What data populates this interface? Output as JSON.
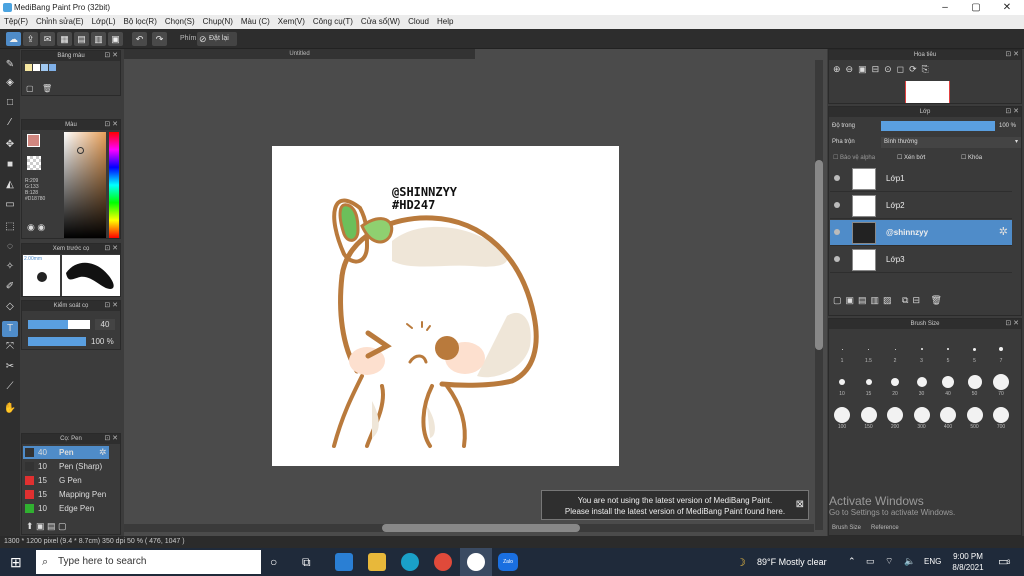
{
  "window": {
    "title": "MediBang Paint Pro (32bit)"
  },
  "menu": [
    "Tệp(F)",
    "Chỉnh sửa(E)",
    "Lớp(L)",
    "Bộ lọc(R)",
    "Chọn(S)",
    "Chụp(N)",
    "Màu (C)",
    "Xem(V)",
    "Công cụ(T)",
    "Cửa sổ(W)",
    "Cloud",
    "Help"
  ],
  "toolbar": {
    "snap_label": "Phím",
    "reset_label": "Đặt lại"
  },
  "panels": {
    "color_box": "Bảng màu",
    "color": "Màu",
    "rgb": {
      "r": "R:209",
      "g": "G:133",
      "b": "B:128",
      "hex": "#D18780"
    },
    "brush_preview": "Xem trước cọ",
    "brush_size_value": "2.00mm",
    "control": "Kiểm soát cọ",
    "control_size": "40",
    "control_opacity": "100 %",
    "brush_list_title": "Cọ: Pen",
    "brushes": [
      {
        "size": "40",
        "name": "Pen",
        "color": "#3a3a3a"
      },
      {
        "size": "10",
        "name": "Pen (Sharp)",
        "color": "#3a3a3a"
      },
      {
        "size": "15",
        "name": "G Pen",
        "color": "#e03030"
      },
      {
        "size": "15",
        "name": "Mapping Pen",
        "color": "#e03030"
      },
      {
        "size": "10",
        "name": "Edge Pen",
        "color": "#30b030"
      }
    ]
  },
  "canvas": {
    "tab_title": "Untitled",
    "text_line1": "@SHINNZYY",
    "text_line2": "#HD247"
  },
  "navigator": {
    "title": "Hoa tiêu"
  },
  "layer": {
    "title": "Lớp",
    "opacity_label": "Độ trong",
    "opacity_value": "100 %",
    "opacity_fraction": 1.0,
    "blend_label": "Pha trộn",
    "blend_value": "Bình thường",
    "protect_alpha": "Bảo vệ alpha",
    "clipping": "Xén bớt",
    "lock": "Khóa",
    "items": [
      {
        "name": "Lớp1",
        "selected": false
      },
      {
        "name": "Lớp2",
        "selected": false
      },
      {
        "name": "@shinnzyy",
        "selected": true
      },
      {
        "name": "Lớp3",
        "selected": false
      }
    ]
  },
  "brush_size": {
    "title": "Brush Size",
    "labels": [
      "1",
      "1.5",
      "2",
      "3",
      "5",
      "5",
      "7",
      "10",
      "15",
      "20",
      "30",
      "40",
      "50",
      "70",
      "100",
      "150",
      "200",
      "300",
      "400",
      "500",
      "700"
    ],
    "tab1": "Brush Size",
    "tab2": "Reference"
  },
  "status": {
    "text": "1300 * 1200 pixel   (9.4 * 8.7cm)   350 dpi   50 %   ( 476, 1047 )"
  },
  "toast": {
    "line1": "You are not using the latest version of MediBang Paint.",
    "line2": "Please install the latest version of MediBang Paint found here."
  },
  "activate": {
    "line1": "Activate Windows",
    "line2": "Go to Settings to activate Windows."
  },
  "taskbar": {
    "search_placeholder": "Type here to search",
    "weather": "89°F  Mostly clear",
    "lang": "ENG",
    "time": "9:00 PM",
    "date": "8/8/2021",
    "notif_count": "3",
    "zalo": "Zalo"
  },
  "colors": {
    "accent": "#4f8cc9",
    "main_color": "#D18780",
    "bun_outline": "#b97a3c",
    "leaf": "#6cbf5a"
  }
}
